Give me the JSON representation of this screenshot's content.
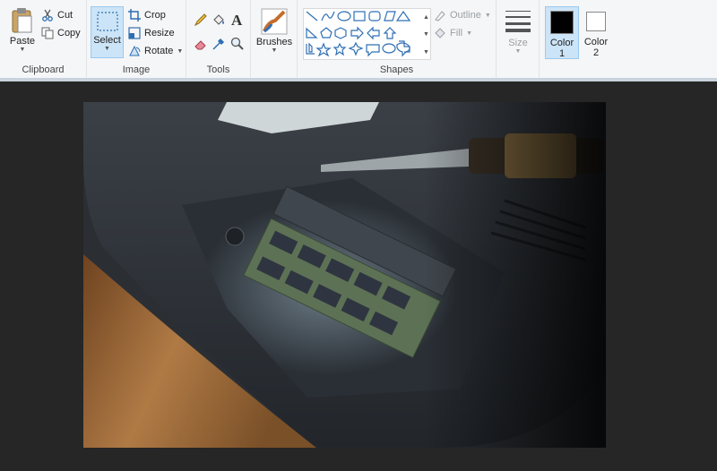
{
  "ribbon": {
    "clipboard": {
      "group_label": "Clipboard",
      "paste_label": "Paste",
      "cut_label": "Cut",
      "copy_label": "Copy"
    },
    "image": {
      "group_label": "Image",
      "select_label": "Select",
      "crop_label": "Crop",
      "resize_label": "Resize",
      "rotate_label": "Rotate"
    },
    "tools": {
      "group_label": "Tools"
    },
    "brushes": {
      "label": "Brushes"
    },
    "shapes": {
      "group_label": "Shapes",
      "outline_label": "Outline",
      "fill_label": "Fill"
    },
    "size": {
      "label": "Size"
    },
    "color1": {
      "label_line1": "Color",
      "label_line2": "1",
      "value": "#000000"
    },
    "color2": {
      "label_line1": "Color",
      "label_line2": "2",
      "value": "#ffffff"
    }
  },
  "colors": {
    "ribbon_bg": "#f5f6f7",
    "workspace_bg": "#262626",
    "accent": "#cce4f7",
    "icon_blue": "#2f6fb3"
  },
  "icons": [
    "paste-icon",
    "cut-icon",
    "copy-icon",
    "select-icon",
    "crop-icon",
    "resize-icon",
    "rotate-icon",
    "pencil-icon",
    "fill-bucket-icon",
    "text-icon",
    "eraser-icon",
    "color-picker-icon",
    "magnifier-icon",
    "brush-icon",
    "size-icon"
  ]
}
